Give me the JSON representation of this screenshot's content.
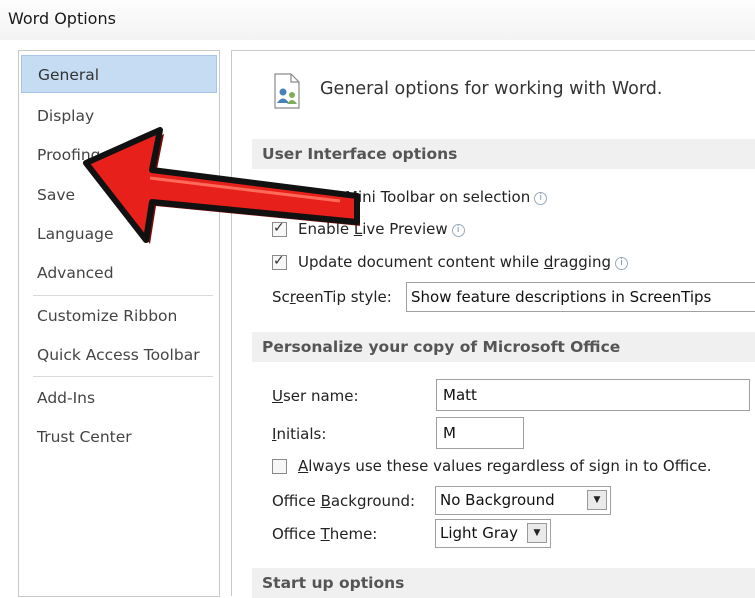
{
  "window": {
    "title": "Word Options"
  },
  "nav": {
    "items": [
      {
        "label": "General"
      },
      {
        "label": "Display"
      },
      {
        "label": "Proofing"
      },
      {
        "label": "Save"
      },
      {
        "label": "Language"
      },
      {
        "label": "Advanced"
      },
      {
        "label": "Customize Ribbon"
      },
      {
        "label": "Quick Access Toolbar"
      },
      {
        "label": "Add-Ins"
      },
      {
        "label": "Trust Center"
      }
    ],
    "selected": "General"
  },
  "header": {
    "text": "General options for working with Word.",
    "icon": "options-people-icon"
  },
  "ui_options": {
    "section_title": "User Interface options",
    "mini_toolbar_tail": "ini Toolbar on selection",
    "live_preview": {
      "before": "Enable ",
      "mnemonic": "L",
      "after": "ive Preview",
      "checked": true
    },
    "update_content": {
      "before": "Update document content while ",
      "mnemonic": "d",
      "after": "ragging",
      "checked": true
    },
    "screentip": {
      "label_a": "Sc",
      "mnemonic": "r",
      "label_b": "eenTip style:",
      "value": "Show feature descriptions in ScreenTips"
    }
  },
  "personalize": {
    "section_title": "Personalize your copy of Microsoft Office",
    "user_name": {
      "mnemonic": "U",
      "label": "ser name:",
      "value": "Matt"
    },
    "initials": {
      "mnemonic": "I",
      "label": "nitials:",
      "value": "M"
    },
    "always_use": {
      "mnemonic": "A",
      "label": "lways use these values regardless of sign in to Office.",
      "checked": false
    },
    "office_background": {
      "label_a": "Office ",
      "mnemonic": "B",
      "label_b": "ackground:",
      "value": "No Background"
    },
    "office_theme": {
      "label_a": "Office ",
      "mnemonic": "T",
      "label_b": "heme:",
      "value": "Light Gray"
    }
  },
  "startup": {
    "section_title": "Start up options"
  },
  "colors": {
    "selected_bg": "#c5dcf2",
    "arrow": "#e8201c",
    "section_bg": "#f0f0f0"
  }
}
